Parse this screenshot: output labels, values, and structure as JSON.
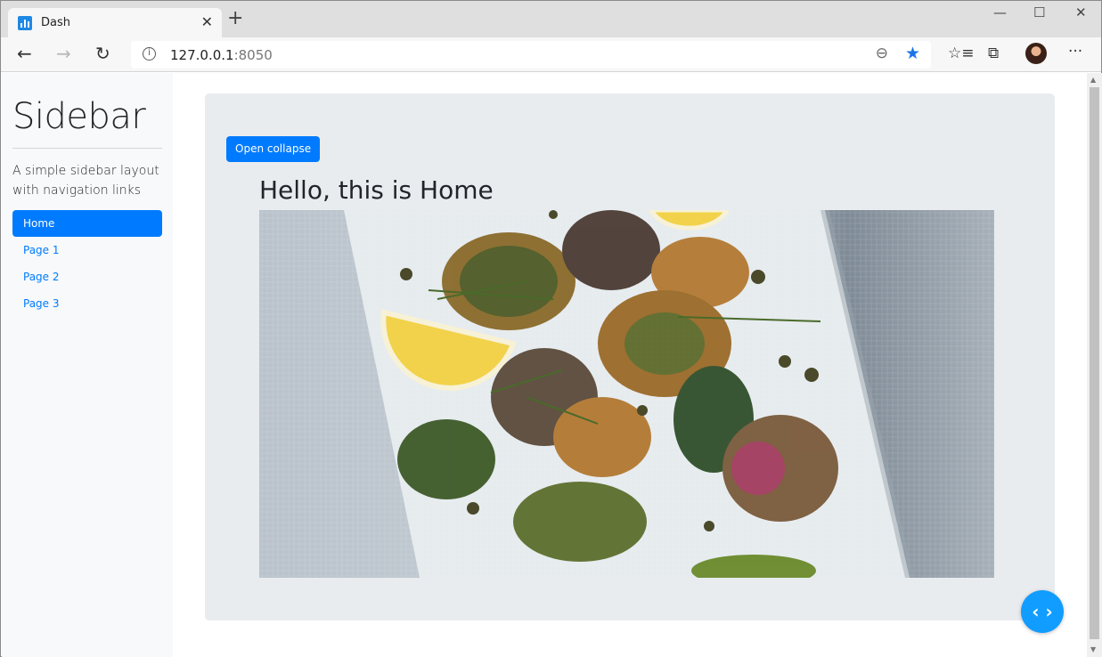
{
  "browser": {
    "tab_title": "Dash",
    "tab_close": "✕",
    "new_tab": "+",
    "minimize": "—",
    "maximize": "☐",
    "close": "✕",
    "back": "←",
    "forward": "→",
    "refresh": "↻",
    "info": "i",
    "url_host": "127.0.0.1",
    "url_port": ":8050",
    "zoom": "⊖",
    "favorite": "★",
    "favorites_list": "☆≡",
    "collections": "⧉",
    "more": "···",
    "accent_color": "#1a73e8"
  },
  "sidebar": {
    "title": "Sidebar",
    "lead": "A simple sidebar layout with navigation links",
    "items": [
      {
        "label": "Home",
        "active": true
      },
      {
        "label": "Page 1",
        "active": false
      },
      {
        "label": "Page 2",
        "active": false
      },
      {
        "label": "Page 3",
        "active": false
      }
    ],
    "active_color": "#007bff"
  },
  "main": {
    "collapse_button": "Open collapse",
    "heading": "Hello, this is Home",
    "image_subject": "food-photo"
  },
  "debug_button": {
    "label": "‹ ›",
    "color": "#119dff"
  }
}
